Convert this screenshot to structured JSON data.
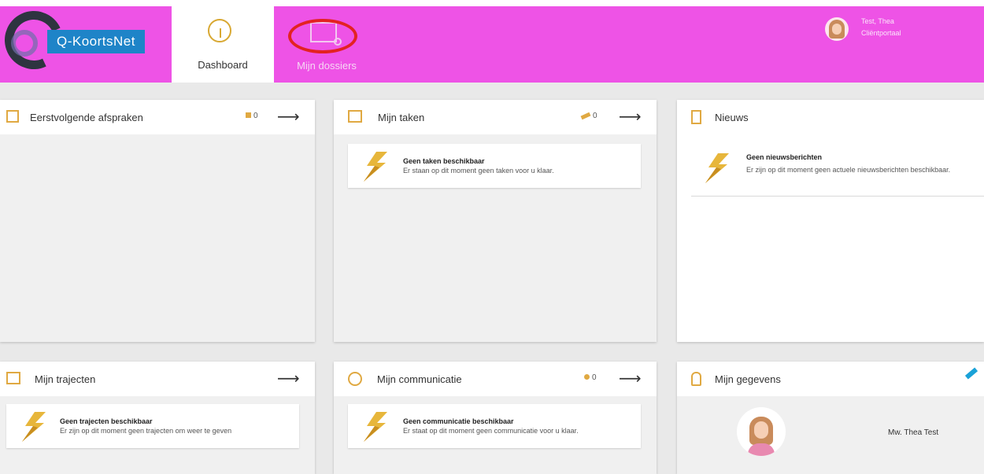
{
  "header": {
    "logo_text": "Q-KoortsNet",
    "nav": [
      {
        "label": "Dashboard",
        "icon": "gauge-icon"
      },
      {
        "label": "Mijn dossiers",
        "icon": "folder-search-icon"
      }
    ],
    "user": {
      "name": "Test, Thea",
      "role": "Cliëntportaal"
    }
  },
  "cards": {
    "afspraken": {
      "title": "Eerstvolgende afspraken",
      "count": "0"
    },
    "taken": {
      "title": "Mijn taken",
      "count": "0",
      "empty_title": "Geen taken beschikbaar",
      "empty_text": "Er staan op dit moment geen taken voor u klaar."
    },
    "nieuws": {
      "title": "Nieuws",
      "empty_title": "Geen nieuwsberichten",
      "empty_text": "Er zijn op dit moment geen actuele nieuwsberichten beschikbaar."
    },
    "trajecten": {
      "title": "Mijn trajecten",
      "empty_title": "Geen trajecten beschikbaar",
      "empty_text": "Er zijn op dit moment geen trajecten om weer te geven"
    },
    "communicatie": {
      "title": "Mijn communicatie",
      "count": "0",
      "empty_title": "Geen communicatie beschikbaar",
      "empty_text": "Er staat op dit moment geen communicatie voor u klaar."
    },
    "gegevens": {
      "title": "Mijn gegevens",
      "name": "Mw. Thea Test"
    }
  },
  "colors": {
    "header": "#ee53e6",
    "accent": "#e0a942",
    "logo_badge": "#1e84c8",
    "highlight": "#e32222"
  }
}
